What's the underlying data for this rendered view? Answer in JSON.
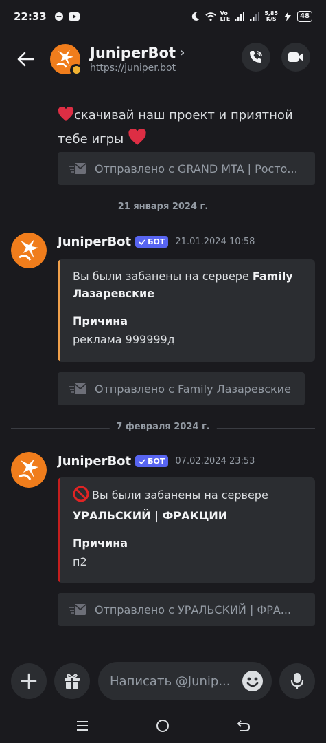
{
  "status_bar": {
    "time": "22:33",
    "network": "5,85\nK/S",
    "volte": "Vo\nLTE",
    "battery": "48"
  },
  "header": {
    "title": "JuniperBot",
    "subtitle": "https://juniper.bot",
    "chevron": "›"
  },
  "messages": [
    {
      "text": "скачивай наш проект и приятной тебе игры",
      "forwarded_from": "Отправлено с GRAND MTA | Росто..."
    },
    {
      "date_divider": "21 января 2024 г.",
      "author": "JuniperBot",
      "badge": "БОТ",
      "timestamp": "21.01.2024 10:58",
      "embed": {
        "desc_prefix": "Вы были забанены на сервере ",
        "server": "Family Лазаревские",
        "field_name": "Причина",
        "field_value": "реклама 999999д",
        "color": "#f0a04b"
      },
      "forwarded_from": "Отправлено с Family Лазаревские"
    },
    {
      "date_divider": "7 февраля 2024 г.",
      "author": "JuniperBot",
      "badge": "БОТ",
      "timestamp": "07.02.2024 23:53",
      "embed": {
        "desc_prefix": "Вы были забанены на сервере",
        "server": "УРАЛЬСКИЙ | ФРАКЦИИ",
        "field_name": "Причина",
        "field_value": "п2",
        "color": "#c41e1e"
      },
      "forwarded_from": "Отправлено с УРАЛЬСКИЙ | ФРА..."
    }
  ],
  "composer": {
    "placeholder": "Написать @Junip..."
  },
  "icons": {
    "back": "arrow-left-icon",
    "call": "phone-call-icon",
    "video": "video-camera-icon",
    "add": "plus-icon",
    "gift": "gift-icon",
    "emoji": "smiley-icon",
    "mic": "microphone-icon",
    "forward": "envelope-icon",
    "ban": "prohibited-icon",
    "heart": "red-heart-icon"
  },
  "colors": {
    "background": "#1a1a1e",
    "surface": "#2b2d31",
    "bot_badge": "#5865f2",
    "status_idle": "#f0b232"
  }
}
